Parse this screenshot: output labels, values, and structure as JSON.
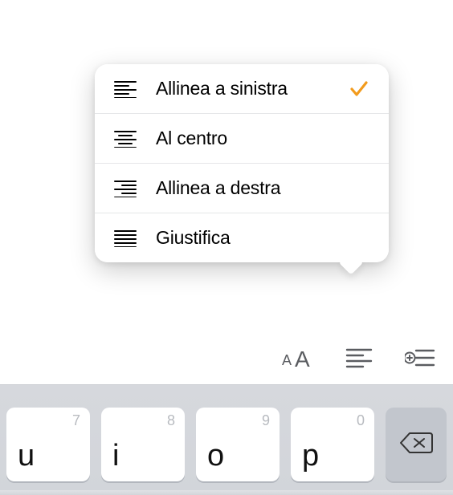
{
  "menu": {
    "selected_index": 0,
    "items": [
      {
        "icon": "align-left",
        "label": "Allinea a sinistra",
        "checked": true
      },
      {
        "icon": "align-center",
        "label": "Al centro",
        "checked": false
      },
      {
        "icon": "align-right",
        "label": "Allinea a destra",
        "checked": false
      },
      {
        "icon": "align-justify",
        "label": "Giustifica",
        "checked": false
      }
    ]
  },
  "toolbar": {
    "text_format_icon": "text-format",
    "alignment_icon": "alignment",
    "list_insert_icon": "list-insert"
  },
  "keyboard": {
    "keys": [
      {
        "main": "u",
        "hint": "7"
      },
      {
        "main": "i",
        "hint": "8"
      },
      {
        "main": "o",
        "hint": "9"
      },
      {
        "main": "p",
        "hint": "0"
      }
    ],
    "backspace_icon": "backspace"
  },
  "colors": {
    "accent": "#f29b1d"
  }
}
